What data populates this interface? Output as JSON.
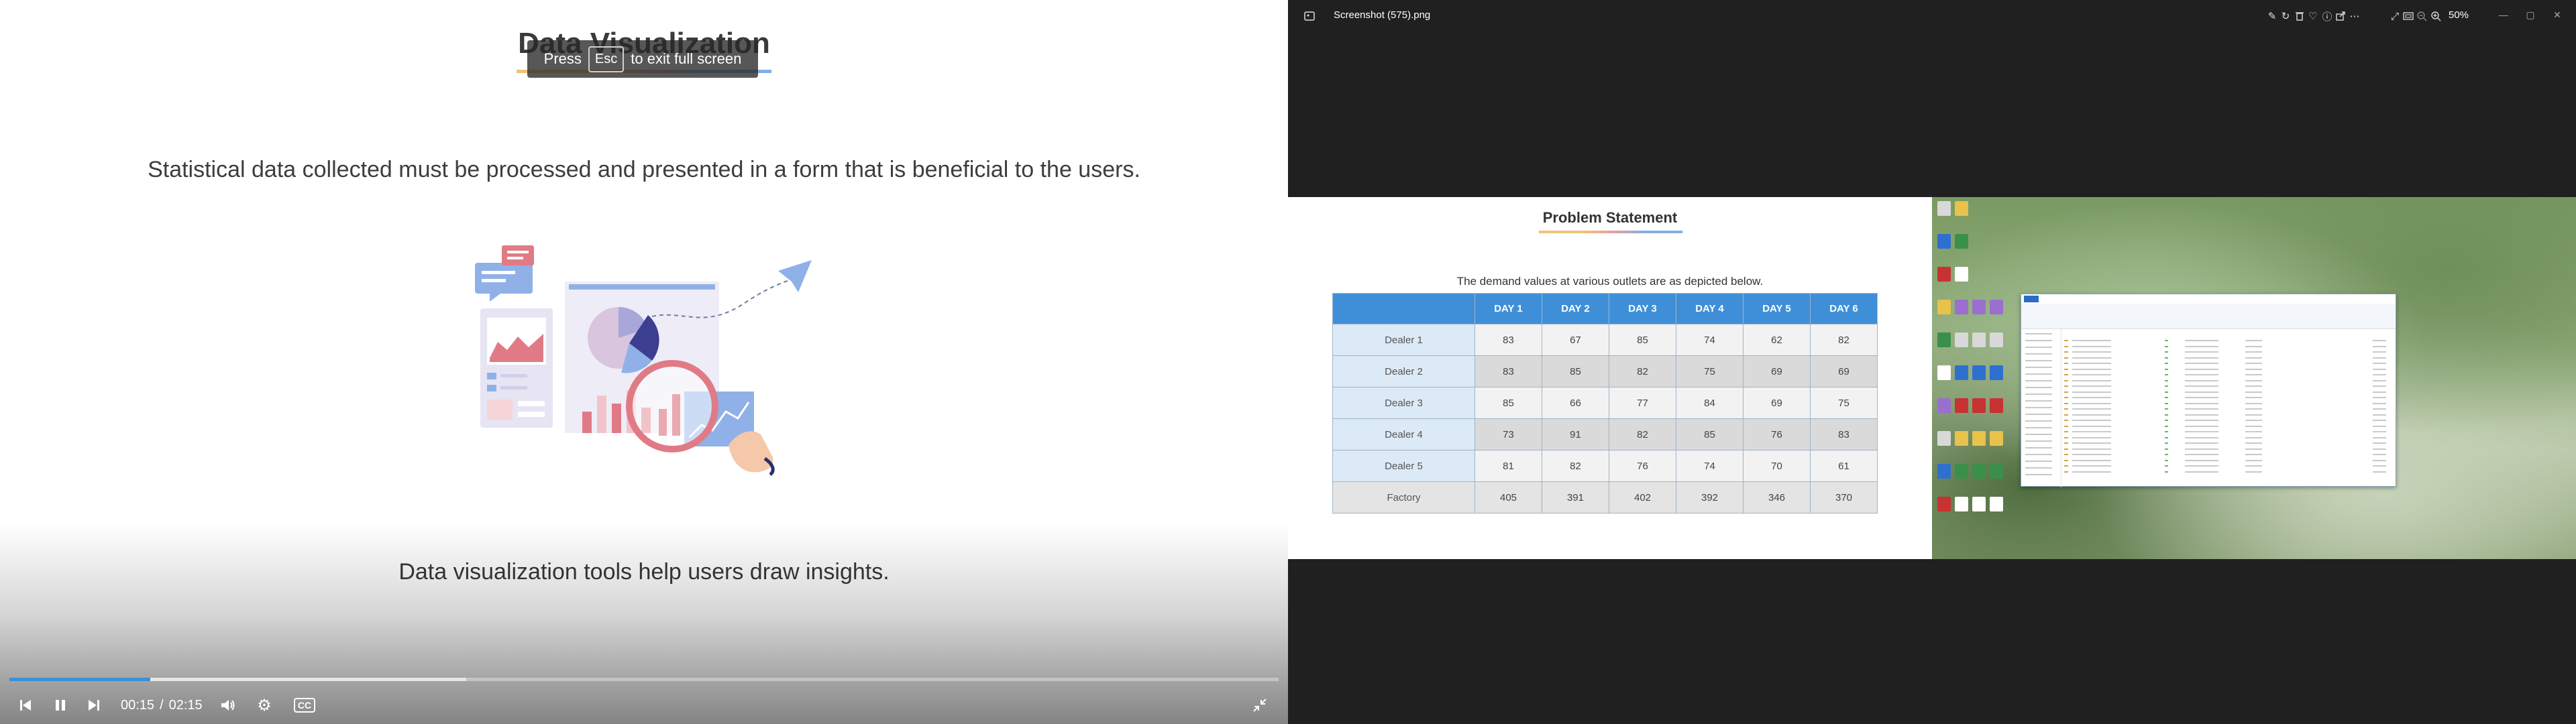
{
  "video_player": {
    "slide_title": "Data Visualization",
    "fullscreen_toast": {
      "prefix": "Press",
      "key": "Esc",
      "suffix": "to exit full screen"
    },
    "statement": "Statistical data collected must be processed and presented in a form that is beneficial to the users.",
    "caption": "Data visualization tools help users draw insights.",
    "progress": {
      "played_fraction": 0.111,
      "buffered_fraction": 0.36
    },
    "current_time": "00:15",
    "separator": "/",
    "duration": "02:15",
    "cc_label": "CC",
    "icons": {
      "previous": "skip-previous-icon",
      "pause": "pause-icon",
      "next": "skip-next-icon",
      "volume": "volume-icon",
      "settings": "gear-icon",
      "captions": "closed-captions-icon",
      "exit_fullscreen": "exit-fullscreen-icon"
    }
  },
  "photo_viewer": {
    "file_name": "Screenshot (575).png",
    "zoom": "50%",
    "accent_color": "#3f8fd8",
    "slide": {
      "title": "Problem Statement",
      "subtitle": "The demand values at various outlets are as depicted below.",
      "columns": [
        "DAY 1",
        "DAY 2",
        "DAY 3",
        "DAY 4",
        "DAY 5",
        "DAY 6"
      ],
      "rows": [
        {
          "label": "Dealer 1",
          "values": [
            "83",
            "67",
            "85",
            "74",
            "62",
            "82"
          ]
        },
        {
          "label": "Dealer 2",
          "values": [
            "83",
            "85",
            "82",
            "75",
            "69",
            "69"
          ]
        },
        {
          "label": "Dealer 3",
          "values": [
            "85",
            "66",
            "77",
            "84",
            "69",
            "75"
          ]
        },
        {
          "label": "Dealer 4",
          "values": [
            "73",
            "91",
            "82",
            "85",
            "76",
            "83"
          ]
        },
        {
          "label": "Dealer 5",
          "values": [
            "81",
            "82",
            "76",
            "74",
            "70",
            "61"
          ]
        },
        {
          "label": "Factory",
          "values": [
            "405",
            "391",
            "402",
            "392",
            "346",
            "370"
          ]
        }
      ]
    },
    "toolbar_icons": [
      "edit-icon",
      "rotate-icon",
      "delete-icon",
      "favorite-icon",
      "info-icon",
      "share-icon",
      "more-icon"
    ],
    "view_icons": [
      "expand-icon",
      "fit-icon",
      "zoom-out-icon",
      "zoom-in-icon"
    ],
    "window_controls": [
      "minimize-icon",
      "maximize-icon",
      "close-icon"
    ]
  }
}
